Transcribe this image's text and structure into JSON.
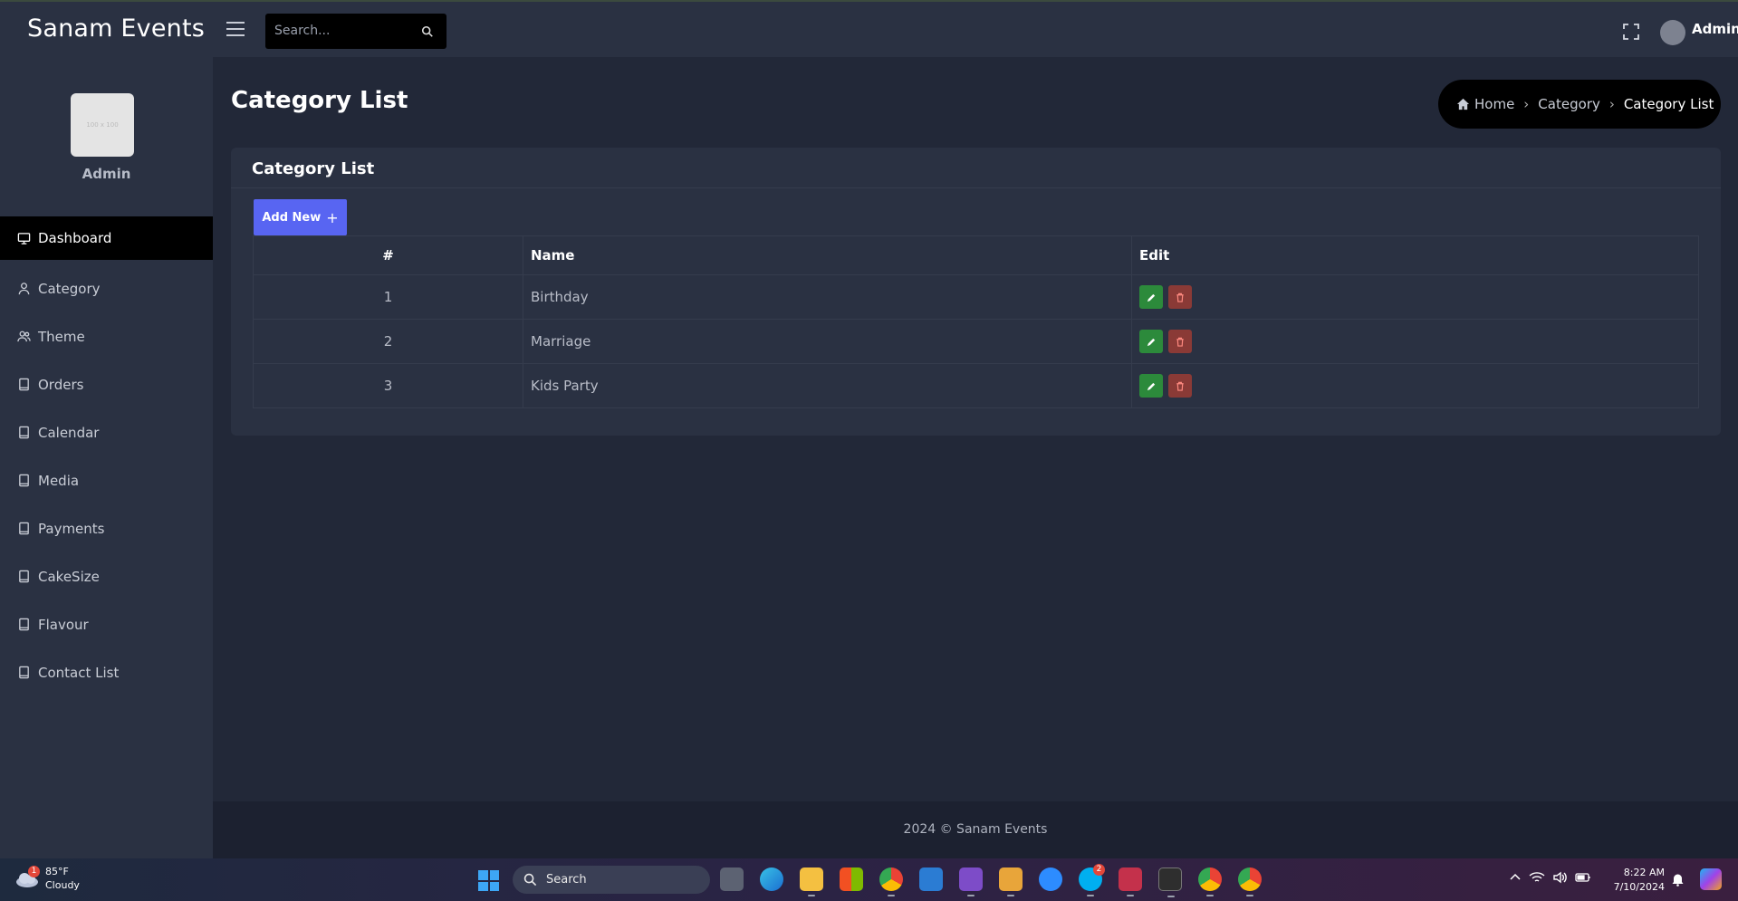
{
  "app": {
    "brand": "Sanam Events",
    "search_placeholder": "Search...",
    "user_name": "Admin"
  },
  "sidebar": {
    "profile_placeholder": "100 x 100",
    "profile_name": "Admin",
    "items": [
      {
        "label": "Dashboard",
        "icon": "monitor-icon",
        "active": true
      },
      {
        "label": "Category",
        "icon": "user-icon"
      },
      {
        "label": "Theme",
        "icon": "users-icon"
      },
      {
        "label": "Orders",
        "icon": "book-icon"
      },
      {
        "label": "Calendar",
        "icon": "book-icon"
      },
      {
        "label": "Media",
        "icon": "book-icon"
      },
      {
        "label": "Payments",
        "icon": "book-icon"
      },
      {
        "label": "CakeSize",
        "icon": "book-icon"
      },
      {
        "label": "Flavour",
        "icon": "book-icon"
      },
      {
        "label": "Contact List",
        "icon": "book-icon"
      }
    ]
  },
  "page": {
    "title": "Category List",
    "breadcrumb": {
      "home": "Home",
      "middle": "Category",
      "current": "Category List"
    }
  },
  "card": {
    "title": "Category List",
    "add_button": "Add New",
    "columns": {
      "num": "#",
      "name": "Name",
      "edit": "Edit"
    },
    "rows": [
      {
        "num": "1",
        "name": "Birthday"
      },
      {
        "num": "2",
        "name": "Marriage"
      },
      {
        "num": "3",
        "name": "Kids Party"
      }
    ]
  },
  "footer": {
    "text": "2024 © Sanam Events"
  },
  "taskbar": {
    "weather_temp": "85°F",
    "weather_desc": "Cloudy",
    "weather_badge": "1",
    "search_label": "Search",
    "time": "8:22 AM",
    "date": "7/10/2024",
    "skype_badge": "2"
  },
  "colors": {
    "accent": "#5865f2",
    "edit": "#2c8a3b",
    "delete": "#8a3a36",
    "sidebar_bg": "#2a3142",
    "page_bg": "#222838"
  }
}
